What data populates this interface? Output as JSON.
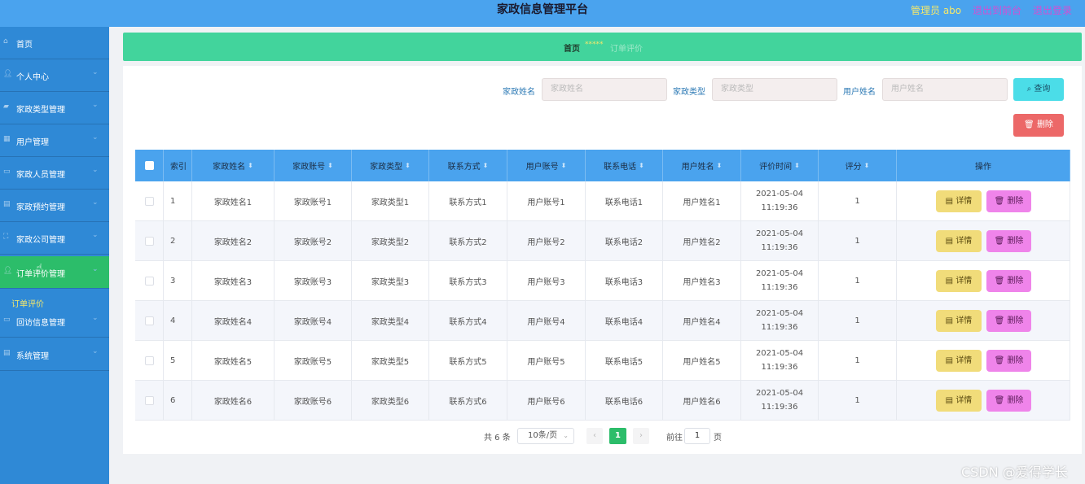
{
  "header": {
    "title": "家政信息管理平台",
    "user": "管理员 abo",
    "back_link": "退出到前台",
    "logout_link": "退出登录"
  },
  "sidebar": {
    "items": [
      {
        "label": "首页",
        "icon": "home-icon"
      },
      {
        "label": "个人中心",
        "icon": "person-icon"
      },
      {
        "label": "家政类型管理",
        "icon": "category-icon"
      },
      {
        "label": "用户管理",
        "icon": "grid-icon"
      },
      {
        "label": "家政人员管理",
        "icon": "staff-icon"
      },
      {
        "label": "家政预约管理",
        "icon": "calendar-icon"
      },
      {
        "label": "家政公司管理",
        "icon": "company-icon"
      },
      {
        "label": "订单评价管理",
        "icon": "order-icon"
      },
      {
        "label": "回访信息管理",
        "icon": "message-icon"
      },
      {
        "label": "系统管理",
        "icon": "settings-icon"
      }
    ],
    "active_submenu": "订单评价"
  },
  "breadcrumb": {
    "home": "首页",
    "separator": "*****",
    "current": "订单评价"
  },
  "search": {
    "field1_label": "家政姓名",
    "field1_placeholder": "家政姓名",
    "field2_label": "家政类型",
    "field2_placeholder": "家政类型",
    "field3_label": "用户姓名",
    "field3_placeholder": "用户姓名",
    "search_button": "查询",
    "delete_button": "删除"
  },
  "table": {
    "columns": [
      "索引",
      "家政姓名",
      "家政账号",
      "家政类型",
      "联系方式",
      "用户账号",
      "联系电话",
      "用户姓名",
      "评价时间",
      "评分",
      "操作"
    ],
    "rows": [
      {
        "idx": "1",
        "name": "家政姓名1",
        "account": "家政账号1",
        "type": "家政类型1",
        "contact": "联系方式1",
        "user_account": "用户账号1",
        "phone": "联系电话1",
        "user_name": "用户姓名1",
        "time": "2021-05-04 11:19:36",
        "score": "1"
      },
      {
        "idx": "2",
        "name": "家政姓名2",
        "account": "家政账号2",
        "type": "家政类型2",
        "contact": "联系方式2",
        "user_account": "用户账号2",
        "phone": "联系电话2",
        "user_name": "用户姓名2",
        "time": "2021-05-04 11:19:36",
        "score": "1"
      },
      {
        "idx": "3",
        "name": "家政姓名3",
        "account": "家政账号3",
        "type": "家政类型3",
        "contact": "联系方式3",
        "user_account": "用户账号3",
        "phone": "联系电话3",
        "user_name": "用户姓名3",
        "time": "2021-05-04 11:19:36",
        "score": "1"
      },
      {
        "idx": "4",
        "name": "家政姓名4",
        "account": "家政账号4",
        "type": "家政类型4",
        "contact": "联系方式4",
        "user_account": "用户账号4",
        "phone": "联系电话4",
        "user_name": "用户姓名4",
        "time": "2021-05-04 11:19:36",
        "score": "1"
      },
      {
        "idx": "5",
        "name": "家政姓名5",
        "account": "家政账号5",
        "type": "家政类型5",
        "contact": "联系方式5",
        "user_account": "用户账号5",
        "phone": "联系电话5",
        "user_name": "用户姓名5",
        "time": "2021-05-04 11:19:36",
        "score": "1"
      },
      {
        "idx": "6",
        "name": "家政姓名6",
        "account": "家政账号6",
        "type": "家政类型6",
        "contact": "联系方式6",
        "user_account": "用户账号6",
        "phone": "联系电话6",
        "user_name": "用户姓名6",
        "time": "2021-05-04 11:19:36",
        "score": "1"
      }
    ],
    "detail_button": "详情",
    "delete_button": "删除"
  },
  "pagination": {
    "total": "共 6 条",
    "page_size": "10条/页",
    "current_page": "1",
    "goto_label": "前往",
    "goto_value": "1",
    "page_suffix": "页"
  },
  "watermark": "CSDN @爱得学长",
  "colors": {
    "header": "#4aa3ee",
    "sidebar": "#2f89d6",
    "active": "#2cbd6a",
    "breadcrumb": "#42d49c",
    "search_button": "#4bdde8",
    "delete_button": "#ec6868",
    "detail_button": "#f1dc7a",
    "row_delete_button": "#ef84ea"
  }
}
